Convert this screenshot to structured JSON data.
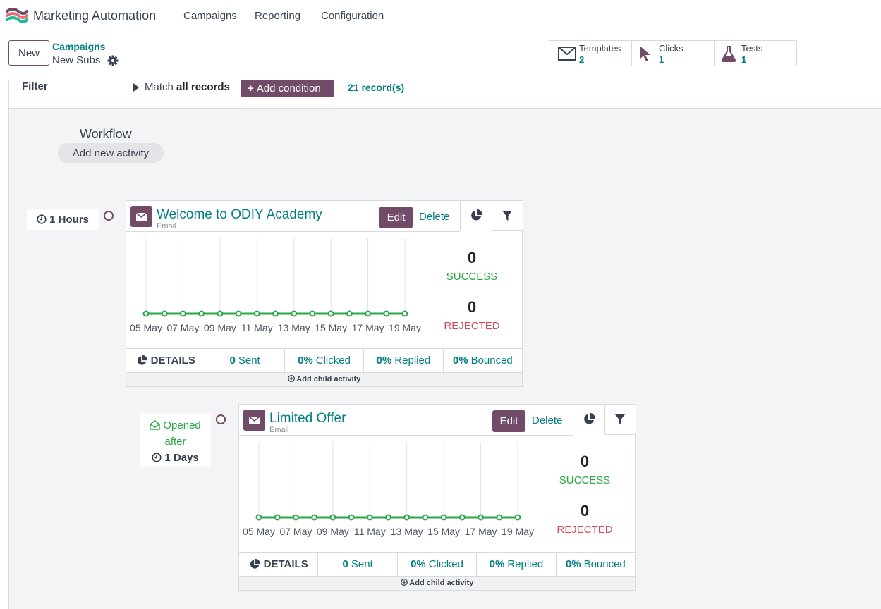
{
  "app": {
    "name": "Marketing Automation",
    "logo_icon": "app-logo-icon"
  },
  "nav": [
    {
      "label": "Campaigns"
    },
    {
      "label": "Reporting"
    },
    {
      "label": "Configuration"
    }
  ],
  "control": {
    "new_label": "New",
    "breadcrumb_parent": "Campaigns",
    "breadcrumb_current": "New Subs",
    "stats": [
      {
        "label": "Templates",
        "value": "2",
        "icon": "envelope-icon"
      },
      {
        "label": "Clicks",
        "value": "1",
        "icon": "cursor-icon"
      },
      {
        "label": "Tests",
        "value": "1",
        "icon": "flask-icon"
      }
    ]
  },
  "filter": {
    "label": "Filter",
    "match_prefix": "Match",
    "match_strong": "all records",
    "add_condition": "Add condition",
    "records": "21 record(s)"
  },
  "workflow": {
    "title": "Workflow",
    "add_activity": "Add new activity"
  },
  "activities": [
    {
      "trigger_time": "1 Hours",
      "title": "Welcome to ODIY Academy",
      "type": "Email",
      "edit": "Edit",
      "delete": "Delete",
      "success_count": "0",
      "success_label": "SUCCESS",
      "rejected_count": "0",
      "rejected_label": "REJECTED",
      "details": "DETAILS",
      "sent_value": "0",
      "sent_label": "Sent",
      "clicked_value": "0%",
      "clicked_label": "Clicked",
      "replied_value": "0%",
      "replied_label": "Replied",
      "bounced_value": "0%",
      "bounced_label": "Bounced",
      "add_child": "Add child activity"
    },
    {
      "trigger_event": "Opened",
      "trigger_word": "after",
      "trigger_time": "1 Days",
      "title": "Limited Offer",
      "type": "Email",
      "edit": "Edit",
      "delete": "Delete",
      "success_count": "0",
      "success_label": "SUCCESS",
      "rejected_count": "0",
      "rejected_label": "REJECTED",
      "details": "DETAILS",
      "sent_value": "0",
      "sent_label": "Sent",
      "clicked_value": "0%",
      "clicked_label": "Clicked",
      "replied_value": "0%",
      "replied_label": "Replied",
      "bounced_value": "0%",
      "bounced_label": "Bounced",
      "add_child": "Add child activity"
    }
  ],
  "chart_data": [
    {
      "type": "line",
      "x": [
        "05 May",
        "06 May",
        "07 May",
        "08 May",
        "09 May",
        "10 May",
        "11 May",
        "12 May",
        "13 May",
        "14 May",
        "15 May",
        "16 May",
        "17 May",
        "18 May",
        "19 May"
      ],
      "tick_labels": [
        "05 May",
        "07 May",
        "09 May",
        "11 May",
        "13 May",
        "15 May",
        "17 May",
        "19 May"
      ],
      "series": [
        {
          "values": [
            0,
            0,
            0,
            0,
            0,
            0,
            0,
            0,
            0,
            0,
            0,
            0,
            0,
            0,
            0
          ],
          "color": "#28a745"
        }
      ],
      "grid": "vertical"
    },
    {
      "type": "line",
      "x": [
        "05 May",
        "06 May",
        "07 May",
        "08 May",
        "09 May",
        "10 May",
        "11 May",
        "12 May",
        "13 May",
        "14 May",
        "15 May",
        "16 May",
        "17 May",
        "18 May",
        "19 May"
      ],
      "tick_labels": [
        "05 May",
        "07 May",
        "09 May",
        "11 May",
        "13 May",
        "15 May",
        "17 May",
        "19 May"
      ],
      "series": [
        {
          "values": [
            0,
            0,
            0,
            0,
            0,
            0,
            0,
            0,
            0,
            0,
            0,
            0,
            0,
            0,
            0
          ],
          "color": "#28a745"
        }
      ],
      "grid": "vertical"
    }
  ],
  "colors": {
    "primary": "#714b67",
    "link": "#017e84",
    "success": "#28a745",
    "danger": "#d44c59"
  }
}
